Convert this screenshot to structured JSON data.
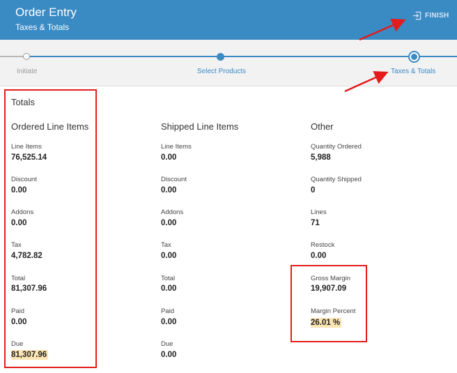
{
  "header": {
    "title": "Order Entry",
    "subtitle": "Taxes & Totals",
    "finish_label": "FINISH",
    "color": "#3a8ac4"
  },
  "stepper": {
    "steps": [
      {
        "label": "Initiate",
        "state": "completed"
      },
      {
        "label": "Select Products",
        "state": "completed"
      },
      {
        "label": "Taxes & Totals",
        "state": "current"
      }
    ]
  },
  "totals": {
    "title": "Totals",
    "ordered": {
      "heading": "Ordered Line Items",
      "fields": [
        {
          "label": "Line Items",
          "value": "76,525.14"
        },
        {
          "label": "Discount",
          "value": "0.00"
        },
        {
          "label": "Addons",
          "value": "0.00"
        },
        {
          "label": "Tax",
          "value": "4,782.82"
        },
        {
          "label": "Total",
          "value": "81,307.96"
        },
        {
          "label": "Paid",
          "value": "0.00"
        },
        {
          "label": "Due",
          "value": "81,307.96"
        }
      ]
    },
    "shipped": {
      "heading": "Shipped Line Items",
      "fields": [
        {
          "label": "Line Items",
          "value": "0.00"
        },
        {
          "label": "Discount",
          "value": "0.00"
        },
        {
          "label": "Addons",
          "value": "0.00"
        },
        {
          "label": "Tax",
          "value": "0.00"
        },
        {
          "label": "Total",
          "value": "0.00"
        },
        {
          "label": "Paid",
          "value": "0.00"
        },
        {
          "label": "Due",
          "value": "0.00"
        }
      ]
    },
    "other": {
      "heading": "Other",
      "fields": [
        {
          "label": "Quantity Ordered",
          "value": "5,988"
        },
        {
          "label": "Quantity Shipped",
          "value": "0"
        },
        {
          "label": "Lines",
          "value": "71"
        },
        {
          "label": "Restock",
          "value": "0.00"
        },
        {
          "label": "Gross Margin",
          "value": "19,907.09"
        },
        {
          "label": "Margin Percent",
          "value": "26.01 %"
        }
      ]
    }
  },
  "colors": {
    "accent": "#3a8ac4",
    "highlight": "#fce5b3",
    "annotation_red": "#e41b1b"
  }
}
